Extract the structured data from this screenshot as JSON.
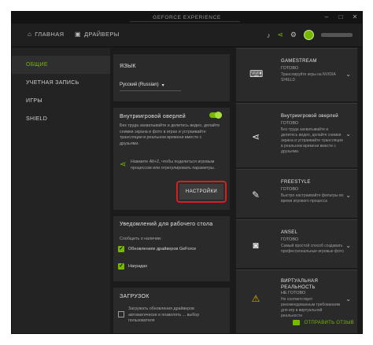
{
  "app": {
    "title": "GEFORCE EXPERIENCE"
  },
  "window_controls": {
    "minimize": "–",
    "maximize": "□",
    "close": "✕"
  },
  "nav": {
    "home": "ГЛАВНАЯ",
    "drivers": "ДРАЙВЕРЫ"
  },
  "sidebar": {
    "items": [
      {
        "label": "ОБЩИЕ",
        "active": true
      },
      {
        "label": "УЧЕТНАЯ ЗАПИСЬ"
      },
      {
        "label": "ИГРЫ"
      },
      {
        "label": "SHIELD"
      }
    ]
  },
  "language": {
    "title": "ЯЗЫК",
    "selected": "Русский (Russian)",
    "arrow": "▾"
  },
  "overlay": {
    "title": "Внутриигровой оверлей",
    "enabled": true,
    "desc": "Без труда захватывайте и делитесь видео, делайте снимки экрана и фото в играх и устраивайте трансляции в реальном времени вместе с друзьями.",
    "hint": "Нажмите Alt+Z, чтобы поделиться игровым процессом или отрегулировать параметры.",
    "settings_button": "НАСТРОЙКИ"
  },
  "notifications": {
    "title": "Уведомлений для рабочего стола",
    "subtitle": "Сообщить о наличии:",
    "items": [
      {
        "label": "Обновлениях драйверов GeForce",
        "checked": true
      },
      {
        "label": "Наградах",
        "checked": true
      }
    ]
  },
  "download": {
    "title": "ЗАГРУЗОК",
    "option": "Загружать обновления драйверов автоматически и позволять ... выбор пользователя"
  },
  "features": [
    {
      "name": "GAMESTREAM",
      "status": "ГОТОВО",
      "desc": "Транслируйте игры на NVIDIA SHIELD",
      "icon": "gamepad-icon"
    },
    {
      "name": "Внутриигровой оверлей",
      "status": "ГОТОВО",
      "desc": "Без труда захватывайте и делитесь видео, делайте снимки экрана и устраивайте трансляции в реальном времени вместе с друзьями.",
      "icon": "share-icon"
    },
    {
      "name": "FREESTYLE",
      "status": "ГОТОВО",
      "desc": "Быстро настраивайте фильтры во время игрового процесса",
      "icon": "edit-icon"
    },
    {
      "name": "ANSEL",
      "status": "ГОТОВО",
      "desc": "Самый простой способ создавать профессиональные игровые фото",
      "icon": "camera-icon"
    },
    {
      "name": "ВИРТУАЛЬНАЯ РЕАЛЬНОСТЬ",
      "status": "НЕ ГОТОВО",
      "desc": "Не соответствует рекомендованным требованиям для игр в виртуальной реальности",
      "icon": "warning-icon"
    }
  ],
  "feedback": {
    "label": "ОТПРАВИТЬ ОТЗЫВ"
  },
  "colors": {
    "accent": "#76b900",
    "highlight": "#d91e1e",
    "background": "#1b1b1b"
  }
}
